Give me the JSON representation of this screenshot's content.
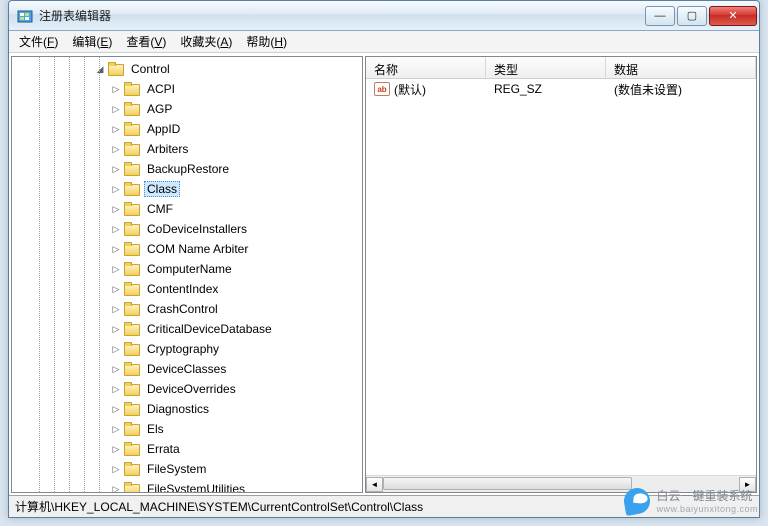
{
  "window": {
    "title": "注册表编辑器"
  },
  "win_buttons": {
    "min": "—",
    "max": "▢",
    "close": "✕"
  },
  "menu": [
    {
      "label": "文件",
      "key": "F"
    },
    {
      "label": "编辑",
      "key": "E"
    },
    {
      "label": "查看",
      "key": "V"
    },
    {
      "label": "收藏夹",
      "key": "A"
    },
    {
      "label": "帮助",
      "key": "H"
    }
  ],
  "tree": {
    "root": "Control",
    "children": [
      "ACPI",
      "AGP",
      "AppID",
      "Arbiters",
      "BackupRestore",
      "Class",
      "CMF",
      "CoDeviceInstallers",
      "COM Name Arbiter",
      "ComputerName",
      "ContentIndex",
      "CrashControl",
      "CriticalDeviceDatabase",
      "Cryptography",
      "DeviceClasses",
      "DeviceOverrides",
      "Diagnostics",
      "Els",
      "Errata",
      "FileSystem",
      "FileSystemUtilities"
    ],
    "selected": "Class"
  },
  "list": {
    "columns": {
      "name": "名称",
      "type": "类型",
      "data": "数据"
    },
    "rows": [
      {
        "icon": "ab",
        "name": "(默认)",
        "type": "REG_SZ",
        "data": "(数值未设置)"
      }
    ]
  },
  "statusbar": {
    "path": "计算机\\HKEY_LOCAL_MACHINE\\SYSTEM\\CurrentControlSet\\Control\\Class"
  },
  "watermark": {
    "brand": "白云一键重装系统",
    "url": "www.baiyunxitong.com"
  }
}
